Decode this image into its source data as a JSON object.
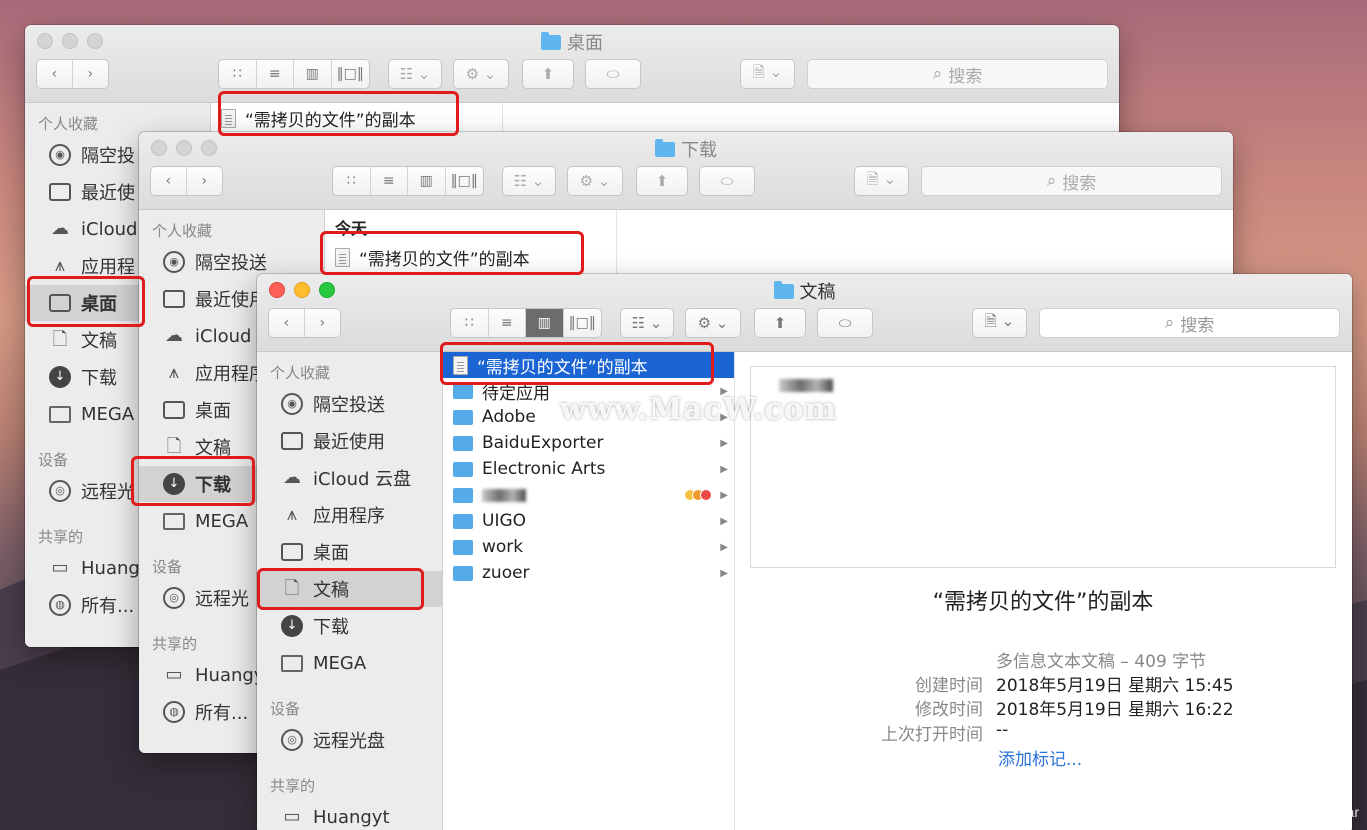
{
  "windows": {
    "desktop": {
      "title": "桌面",
      "search_placeholder": "搜索",
      "file": "“需拷贝的文件”的副本",
      "sidebar_header_fav": "个人收藏",
      "sidebar_items": [
        "隔空投",
        "最近使",
        "iCloud",
        "应用程",
        "桌面",
        "文稿",
        "下载",
        "MEGA"
      ],
      "sidebar_header_devices": "设备",
      "device_item": "远程光",
      "sidebar_header_shared": "共享的",
      "shared_items": [
        "Huang",
        "所有..."
      ]
    },
    "downloads": {
      "title": "下载",
      "search_placeholder": "搜索",
      "group_header": "今天",
      "file": "“需拷贝的文件”的副本",
      "sidebar_header_fav": "个人收藏",
      "sidebar_items": [
        "隔空投送",
        "最近使用",
        "iCloud",
        "应用程序",
        "桌面",
        "文稿",
        "下载",
        "MEGA"
      ],
      "sidebar_header_devices": "设备",
      "device_item": "远程光",
      "sidebar_header_shared": "共享的",
      "shared_items": [
        "Huangy",
        "所有..."
      ]
    },
    "documents": {
      "title": "文稿",
      "search_placeholder": "搜索",
      "sidebar_header_fav": "个人收藏",
      "sidebar_items": [
        "隔空投送",
        "最近使用",
        "iCloud 云盘",
        "应用程序",
        "桌面",
        "文稿",
        "下载",
        "MEGA"
      ],
      "sidebar_header_devices": "设备",
      "device_item": "远程光盘",
      "sidebar_header_shared": "共享的",
      "shared_items": [
        "Huangyt"
      ],
      "files": [
        "“需拷贝的文件”的副本",
        "待定应用",
        "Adobe",
        "BaiduExporter",
        "Electronic Arts",
        "",
        "UIGO",
        "work",
        "zuoer"
      ],
      "preview": {
        "name": "“需拷贝的文件”的副本",
        "kind": "多信息文本文稿 – 409 字节",
        "created_label": "创建时间",
        "created": "2018年5月19日 星期六 15:45",
        "modified_label": "修改时间",
        "modified": "2018年5月19日 星期六 16:22",
        "opened_label": "上次打开时间",
        "opened": "--",
        "add_tags": "添加标记..."
      }
    }
  },
  "watermark": "www.MacW.com",
  "credit": "https://blog.csdn.net/macwbear",
  "colors": {
    "highlight": "#e01b1b",
    "selection": "#1a64d4",
    "folder": "#55aaea"
  }
}
